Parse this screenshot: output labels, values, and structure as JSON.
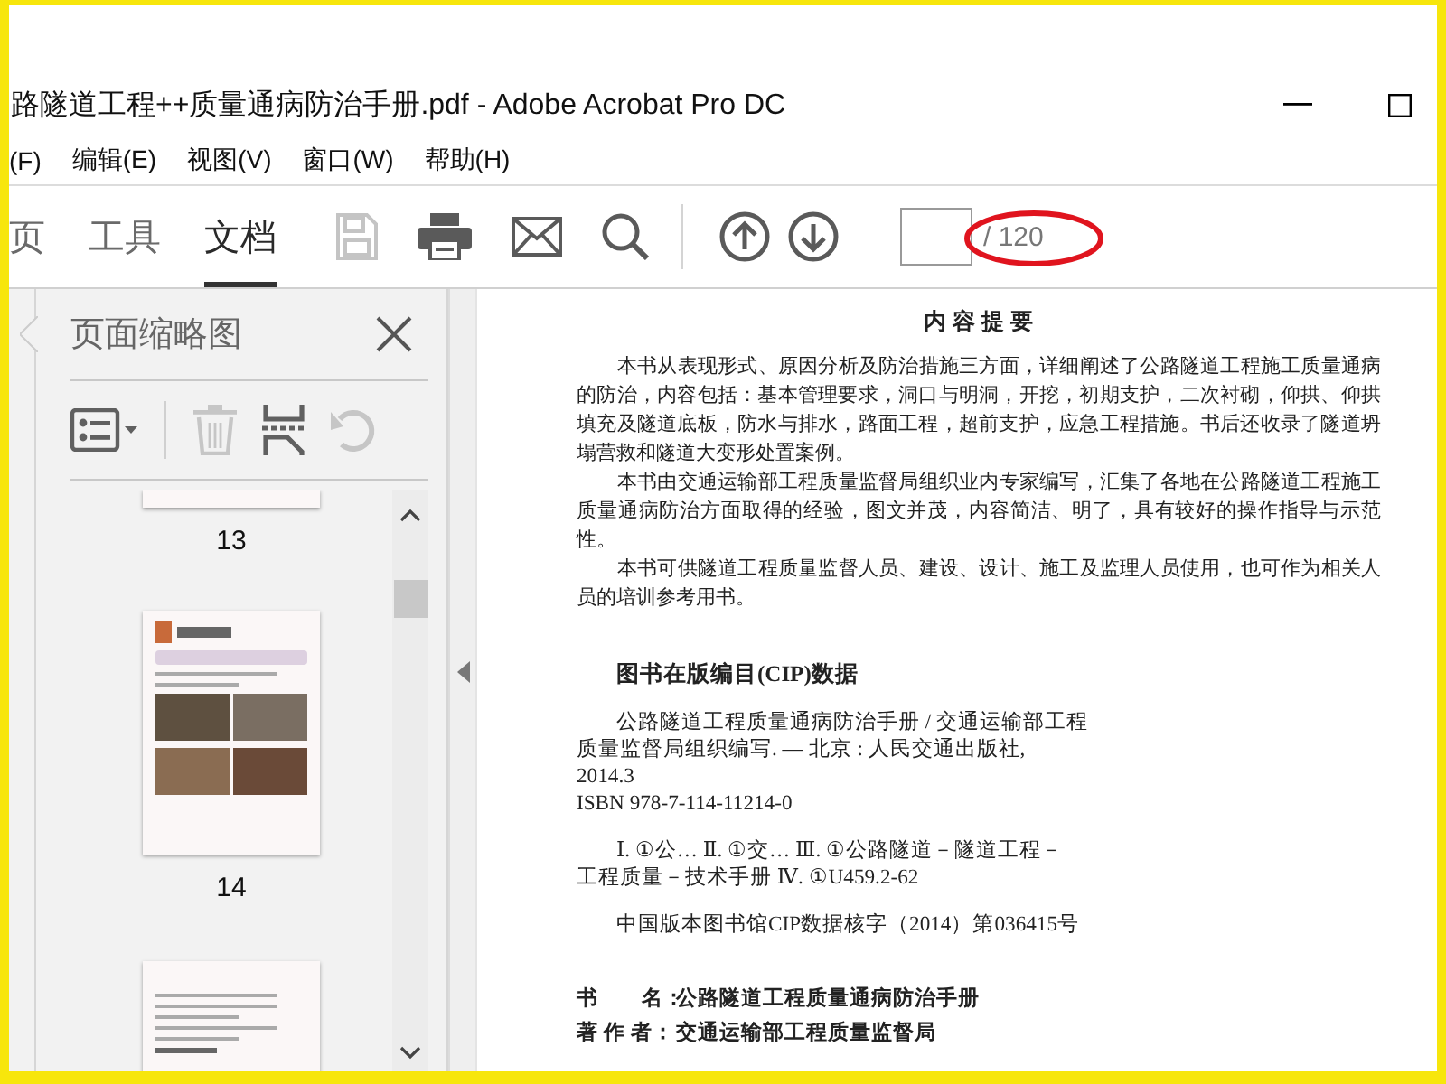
{
  "window": {
    "title": "路隧道工程++质量通病防治手册.pdf - Adobe Acrobat Pro DC"
  },
  "menu": [
    {
      "label": "(F)"
    },
    {
      "label": "编辑(E)"
    },
    {
      "label": "视图(V)"
    },
    {
      "label": "窗口(W)"
    },
    {
      "label": "帮助(H)"
    }
  ],
  "toolbar": {
    "tabs": [
      {
        "label": "页",
        "selected": false
      },
      {
        "label": "工具",
        "selected": false
      },
      {
        "label": "文档",
        "selected": true
      }
    ],
    "buttons": [
      {
        "kind": "save",
        "disabled": true
      },
      {
        "kind": "print",
        "disabled": false
      },
      {
        "kind": "mail",
        "disabled": false
      },
      {
        "kind": "search",
        "disabled": false
      }
    ],
    "nav": [
      {
        "kind": "up"
      },
      {
        "kind": "down"
      }
    ],
    "page_total": "/ 120"
  },
  "thumbnail_panel": {
    "title": "页面缩略图",
    "tools": [
      {
        "kind": "options",
        "disabled": false
      },
      {
        "kind": "delete",
        "disabled": true
      },
      {
        "kind": "insert",
        "disabled": false
      },
      {
        "kind": "rotate",
        "disabled": true
      }
    ],
    "pages": [
      {
        "kind": "clipped-top",
        "label": "13"
      },
      {
        "kind": "photos",
        "label": "14"
      },
      {
        "kind": "clipped-bottom"
      }
    ]
  },
  "document": {
    "heading": "内 容 提 要",
    "paragraphs": [
      "本书从表现形式、原因分析及防治措施三方面，详细阐述了公路隧道工程施工质量通病的防治，内容包括：基本管理要求，洞口与明洞，开挖，初期支护，二次衬砌，仰拱、仰拱填充及隧道底板，防水与排水，路面工程，超前支护，应急工程措施。书后还收录了隧道坍塌营救和隧道大变形处置案例。",
      "本书由交通运输部工程质量监督局组织业内专家编写，汇集了各地在公路隧道工程施工质量通病防治方面取得的经验，图文并茂，内容简洁、明了，具有较好的操作指导与示范性。",
      "本书可供隧道工程质量监督人员、建设、设计、施工及监理人员使用，也可作为相关人员的培训参考用书。"
    ],
    "cip_heading": "图书在版编目(CIP)数据",
    "cip_blocks": [
      {
        "lines": [
          "公路隧道工程质量通病防治手册 / 交通运输部工程",
          "质量监督局组织编写. — 北京 : 人民交通出版社,",
          "2014.3",
          "ISBN 978-7-114-11214-0"
        ]
      },
      {
        "lines": [
          "Ⅰ. ①公… Ⅱ. ①交… Ⅲ. ①公路隧道－隧道工程－",
          "工程质量－技术手册 Ⅳ. ①U459.2-62"
        ]
      },
      {
        "lines": [
          "中国版本图书馆CIP数据核字（2014）第036415号"
        ]
      }
    ],
    "info": [
      {
        "label": "书　　名：",
        "value": "公路隧道工程质量通病防治手册"
      },
      {
        "label": "著 作 者：",
        "value": "交通运输部工程质量监督局"
      }
    ]
  }
}
